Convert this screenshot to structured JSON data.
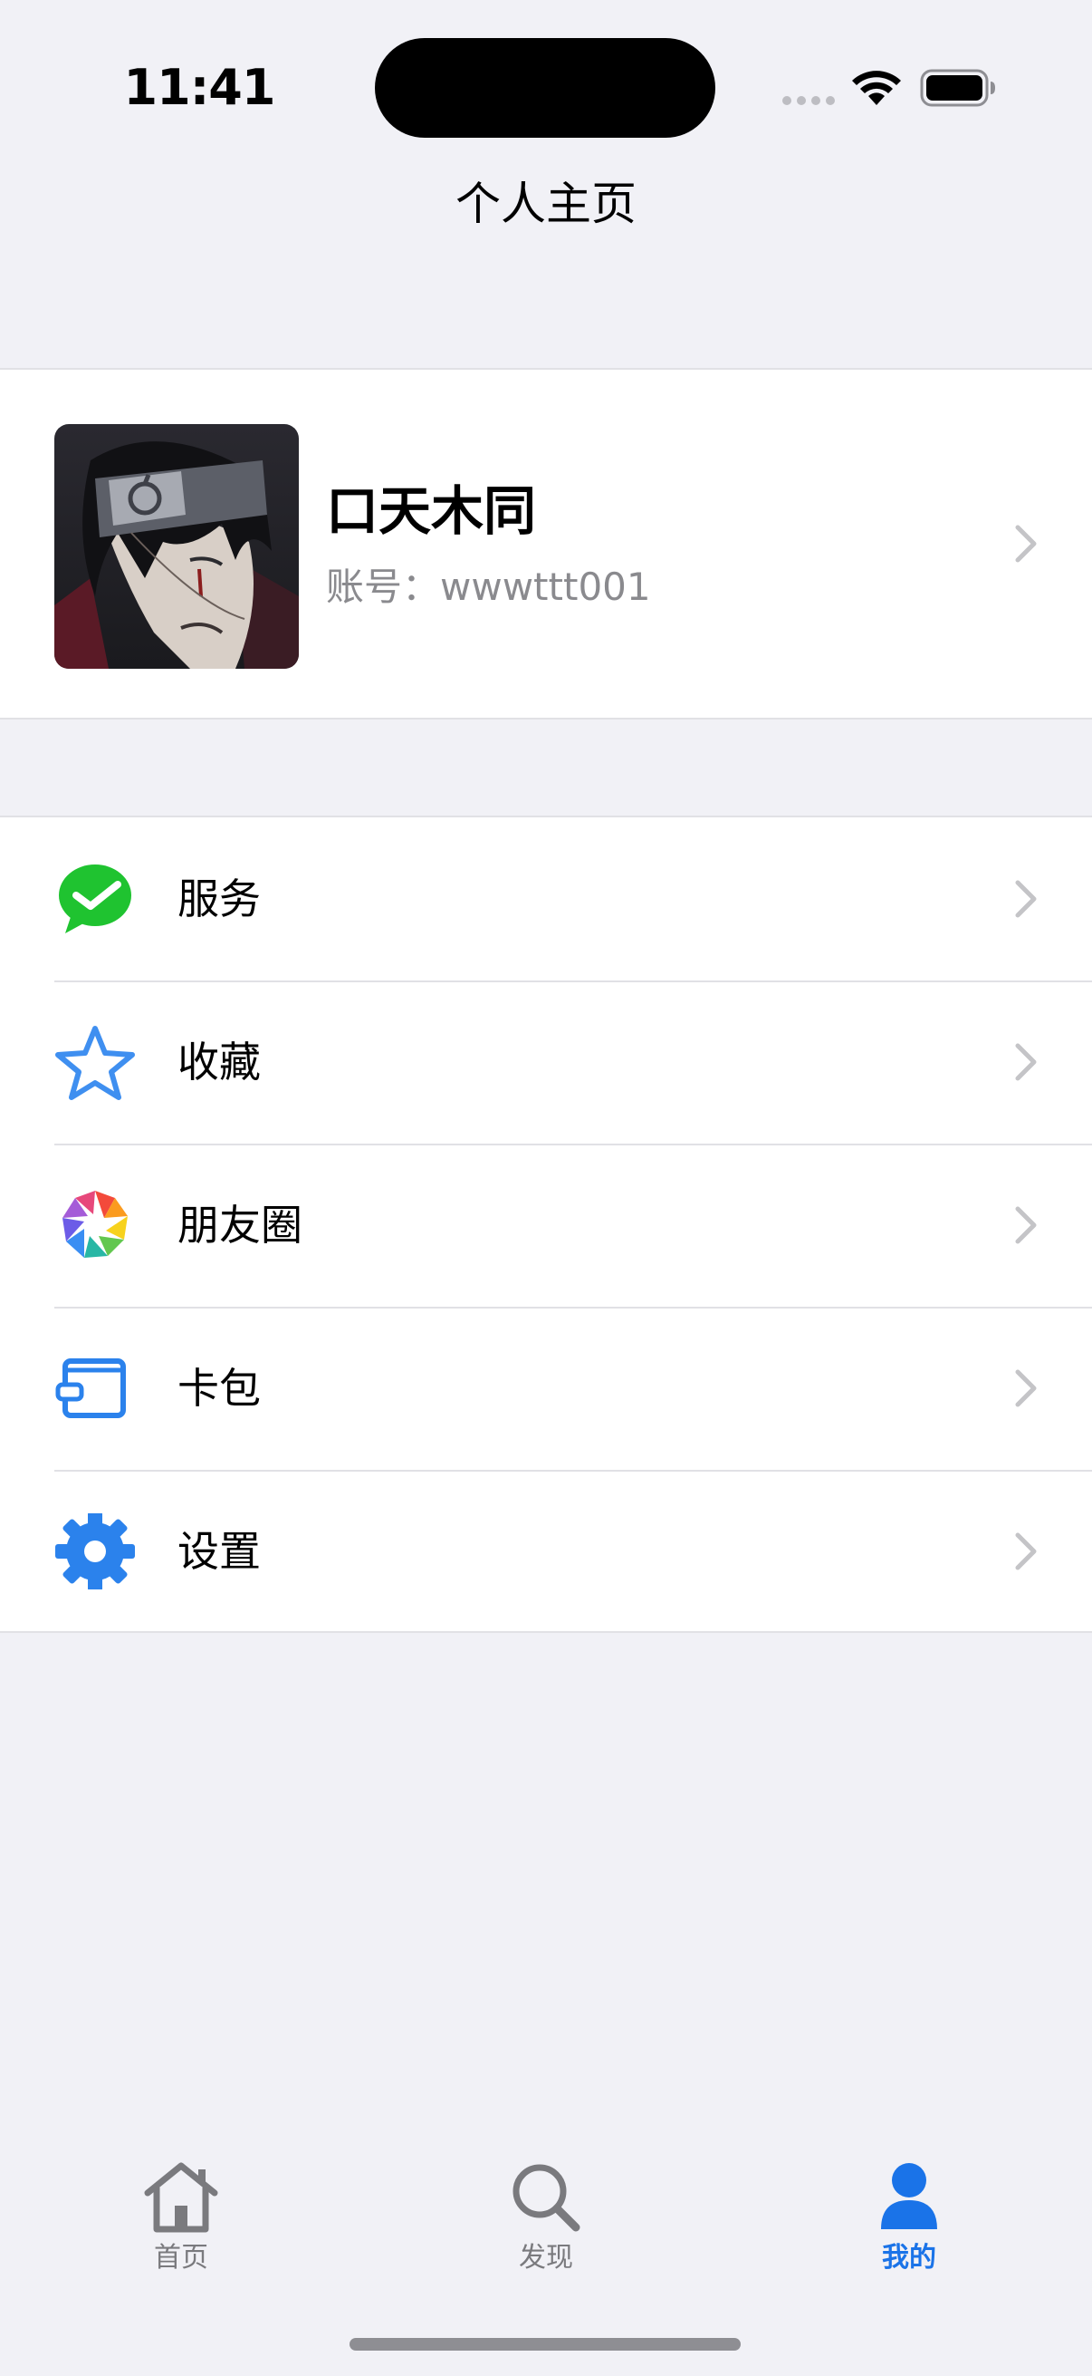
{
  "status_bar": {
    "time": "11:41"
  },
  "nav": {
    "title": "个人主页"
  },
  "profile": {
    "name": "口天木同",
    "account": "账号：wwwttt001"
  },
  "menu": [
    {
      "label": "服务",
      "icon": "wechat-check-icon"
    },
    {
      "label": "收藏",
      "icon": "star-icon"
    },
    {
      "label": "朋友圈",
      "icon": "aperture-icon"
    },
    {
      "label": "卡包",
      "icon": "wallet-icon"
    },
    {
      "label": "设置",
      "icon": "gear-icon"
    }
  ],
  "tab_bar": {
    "items": [
      {
        "label": "首页",
        "icon": "home-icon",
        "active": false
      },
      {
        "label": "发现",
        "icon": "search-icon",
        "active": false
      },
      {
        "label": "我的",
        "icon": "person-icon",
        "active": true
      }
    ],
    "active_color": "#1a73e8",
    "inactive_color": "#7a7a7e"
  },
  "colors": {
    "background": "#f1f1f6",
    "card": "#ffffff",
    "wechat_green": "#1fc330",
    "icon_blue": "#2b82ec"
  }
}
